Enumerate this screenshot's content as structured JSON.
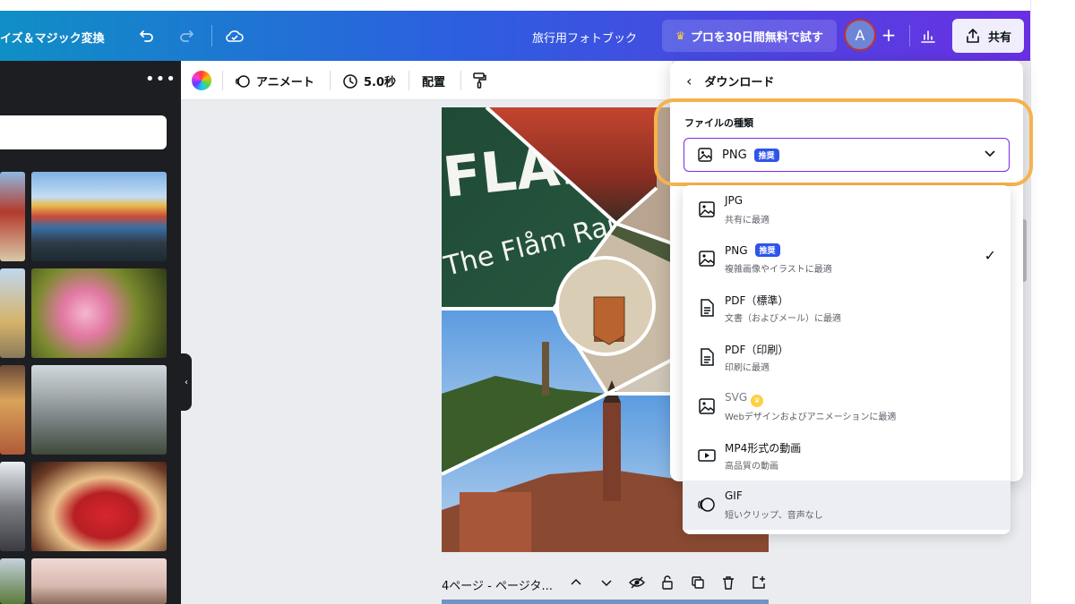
{
  "header": {
    "resize_label": "イズ＆マジック変換",
    "doc_title": "旅行用フォトブック",
    "pro_label": "プロを30日間無料で試す",
    "avatar_initial": "A",
    "plus_symbol": "+",
    "share_label": "共有"
  },
  "toolbar": {
    "animate_label": "アニメート",
    "duration_label": "5.0秒",
    "position_label": "配置"
  },
  "left_panel": {
    "more_symbol": "•••",
    "collapse_symbol": "‹"
  },
  "page_footer": {
    "label": "4ページ - ページタ..."
  },
  "download": {
    "back_symbol": "‹",
    "title": "ダウンロード",
    "file_type_label": "ファイルの種類",
    "selected_value": "PNG",
    "recommended_badge": "推奨"
  },
  "options": [
    {
      "title": "JPG",
      "desc": "共有に最適",
      "icon": "image-icon",
      "selected": false,
      "pro": false,
      "recommended": false
    },
    {
      "title": "PNG",
      "desc": "複雑画像やイラストに最適",
      "icon": "image-icon",
      "selected": true,
      "pro": false,
      "recommended": true
    },
    {
      "title": "PDF（標準）",
      "desc": "文書（およびメール）に最適",
      "icon": "document-icon",
      "selected": false,
      "pro": false,
      "recommended": false
    },
    {
      "title": "PDF（印刷）",
      "desc": "印刷に最適",
      "icon": "document-icon",
      "selected": false,
      "pro": false,
      "recommended": false
    },
    {
      "title": "SVG",
      "desc": "Webデザインおよびアニメーションに最適",
      "icon": "image-icon",
      "selected": false,
      "pro": true,
      "recommended": false
    },
    {
      "title": "MP4形式の動画",
      "desc": "高品質の動画",
      "icon": "video-icon",
      "selected": false,
      "pro": false,
      "recommended": false
    },
    {
      "title": "GIF",
      "desc": "短いクリップ、音声なし",
      "icon": "gif-icon",
      "selected": false,
      "pro": false,
      "recommended": false
    }
  ],
  "check_symbol": "✓",
  "colors": {
    "accent": "#7d2ae8",
    "highlight": "#f6b24b",
    "badge": "#2f54eb"
  }
}
